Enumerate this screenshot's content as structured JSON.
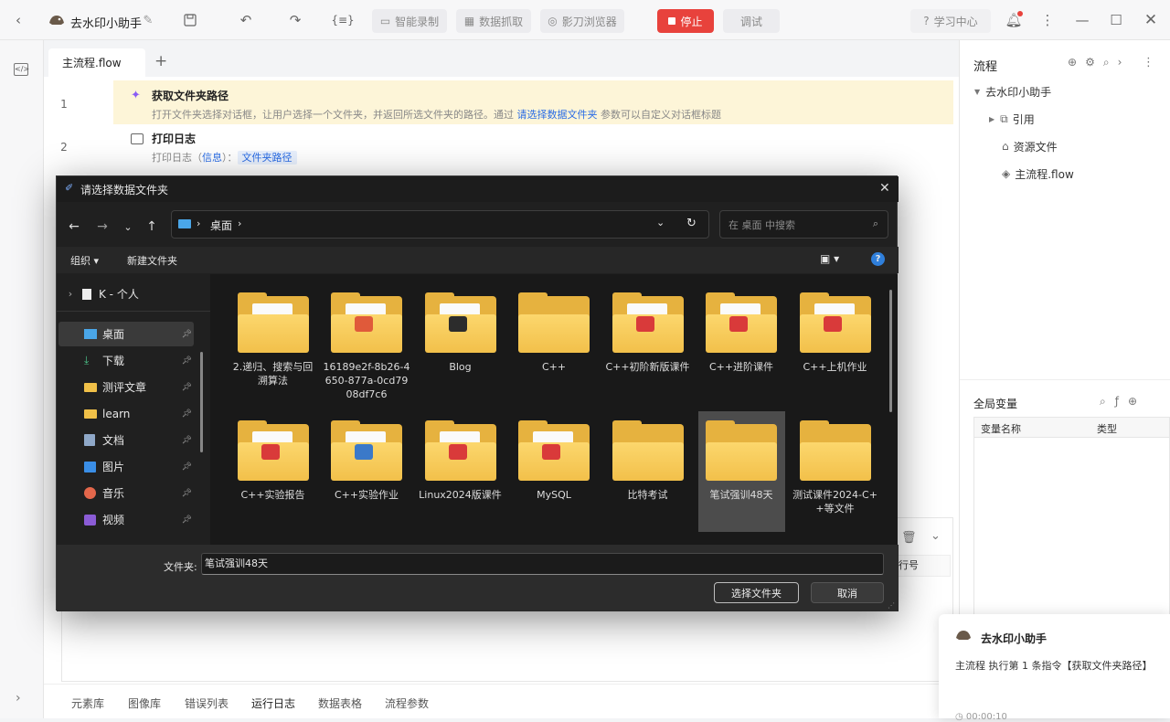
{
  "app": {
    "title": "去水印小助手",
    "toolbar": {
      "smart_record": "智能录制",
      "data_capture": "数据抓取",
      "browser": "影刀浏览器",
      "stop": "停止",
      "debug": "调试",
      "learn_center": "学习中心"
    }
  },
  "editor": {
    "tab": "主流程.flow",
    "steps": [
      {
        "no": "1",
        "title": "获取文件夹路径",
        "desc_pre": "打开文件夹选择对话框，让用户选择一个文件夹，并返回所选文件夹的路径。通过 ",
        "desc_link": "请选择数据文件夹",
        "desc_post": " 参数可以自定义对话框标题"
      },
      {
        "no": "2",
        "title": "打印日志",
        "desc_pre": "打印日志（",
        "desc_link": "信息",
        "desc_mid": "）：",
        "tag": "文件夹路径"
      }
    ]
  },
  "right_panel": {
    "title": "流程",
    "tree": [
      "去水印小助手",
      "引用",
      "资源文件",
      "主流程.flow"
    ],
    "globals_title": "全局变量",
    "col_name": "变量名称",
    "col_type": "类型"
  },
  "bottom": {
    "tabs": [
      "元素库",
      "图像库",
      "错误列表",
      "运行日志",
      "数据表格",
      "流程参数"
    ],
    "row_header": "行号"
  },
  "toast": {
    "title": "去水印小助手",
    "message": "主流程 执行第 1 条指令【获取文件夹路径】",
    "time": "00:00:10"
  },
  "dialog": {
    "title": "请选择数据文件夹",
    "address": "桌面",
    "search_placeholder": "在 桌面 中搜索",
    "organize": "组织",
    "new_folder": "新建文件夹",
    "nav": [
      {
        "label": "K - 个人",
        "icon": "document-icon",
        "pinned": false
      },
      {
        "label": "桌面",
        "icon": "desktop-icon",
        "pinned": true,
        "selected": true
      },
      {
        "label": "下载",
        "icon": "download-icon",
        "pinned": true
      },
      {
        "label": "测评文章",
        "icon": "folder-icon",
        "pinned": true
      },
      {
        "label": "learn",
        "icon": "folder-icon",
        "pinned": true
      },
      {
        "label": "文档",
        "icon": "documents-icon",
        "pinned": true
      },
      {
        "label": "图片",
        "icon": "pictures-icon",
        "pinned": true
      },
      {
        "label": "音乐",
        "icon": "music-icon",
        "pinned": true
      },
      {
        "label": "视频",
        "icon": "video-icon",
        "pinned": true
      }
    ],
    "folders": [
      {
        "label": "2.递归、搜索与回溯算法",
        "content": "paper"
      },
      {
        "label": "16189e2f-8b26-4650-877a-0cd7908df7c6",
        "content": "ppt"
      },
      {
        "label": "Blog",
        "content": "app"
      },
      {
        "label": "C++",
        "content": "empty"
      },
      {
        "label": "C++初阶新版课件",
        "content": "pdf"
      },
      {
        "label": "C++进阶课件",
        "content": "pdf"
      },
      {
        "label": "C++上机作业",
        "content": "pdf"
      },
      {
        "label": "C++实验报告",
        "content": "pdf"
      },
      {
        "label": "C++实验作业",
        "content": "python"
      },
      {
        "label": "Linux2024版课件",
        "content": "pdf"
      },
      {
        "label": "MySQL",
        "content": "pdf"
      },
      {
        "label": "比特考试",
        "content": "empty"
      },
      {
        "label": "笔试强训48天",
        "content": "empty",
        "selected": true
      },
      {
        "label": "测试课件2024-C++等文件",
        "content": "empty"
      }
    ],
    "folder_label": "文件夹:",
    "folder_value": "笔试强训48天",
    "select_button": "选择文件夹",
    "cancel_button": "取消"
  },
  "colors": {
    "accent": "#2b6de5",
    "stop": "#e8423c",
    "highlight": "#fdf5d8"
  }
}
